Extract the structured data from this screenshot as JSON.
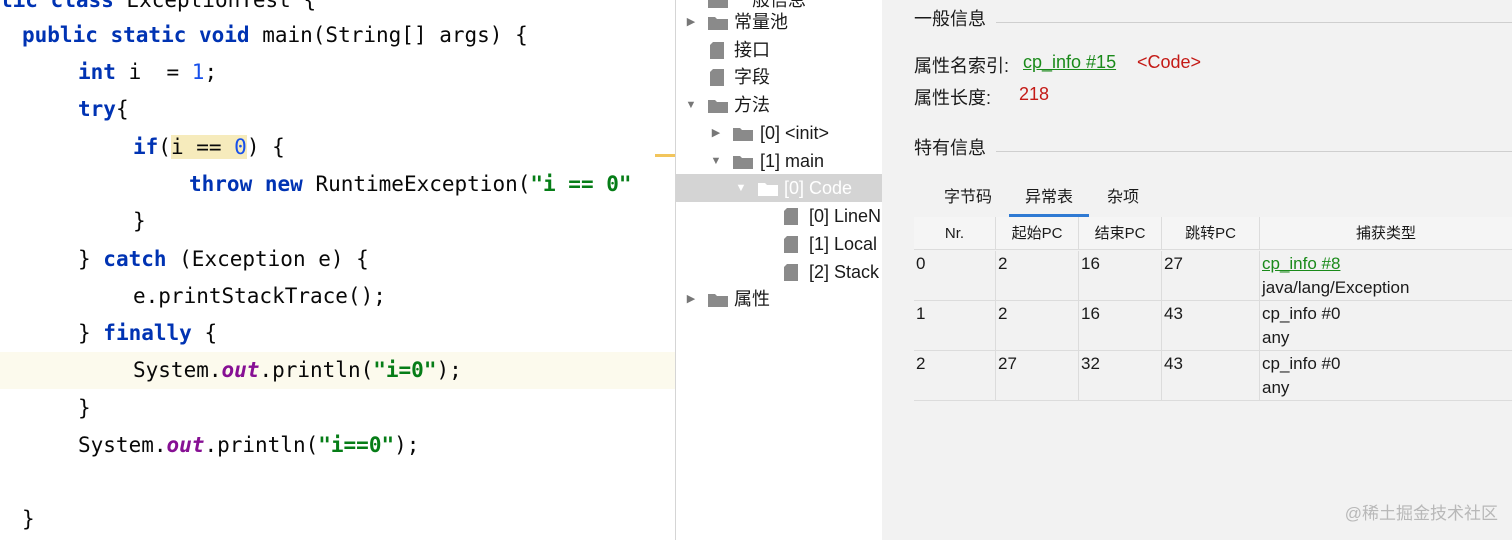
{
  "editor": {
    "lines": [
      "lic class ExceptionTest {",
      "public static void main(String[] args) {",
      "int i  = 1;",
      "try{",
      "if(i == 0) {",
      "throw new RuntimeException(\"i == 0\"",
      "}",
      "} catch (Exception e) {",
      "e.printStackTrace();",
      "} finally {",
      "System.out.println(\"i=0\");",
      "}",
      "System.out.println(\"i==0\");",
      "",
      "}"
    ],
    "tokens": {
      "l0_kw": "lic class",
      "l0_rest": " ExceptionTest {",
      "l1_kw": "public static void",
      "l1_rest": " main(String[] args) {",
      "l2_kw": "int",
      "l2_mid": " i  = ",
      "l2_num": "1",
      "l2_end": ";",
      "l3_kw": "try",
      "l3_end": "{",
      "l4_kw": "if",
      "l4_p": "(",
      "l4_match1": "i == ",
      "l4_num": "0",
      "l4_end": ") {",
      "l5_kw": "throw new",
      "l5_mid": " RuntimeException(",
      "l5_str": "\"i == 0\"",
      "l6": "}",
      "l7_a": "} ",
      "l7_kw": "catch",
      "l7_rest": " (Exception e) {",
      "l8": "e.printStackTrace();",
      "l9_a": "} ",
      "l9_kw": "finally",
      "l9_rest": " {",
      "l10_a": "System.",
      "l10_field": "out",
      "l10_b": ".println(",
      "l10_str": "\"i=0\"",
      "l10_end": ");",
      "l11": "}",
      "l12_a": "System.",
      "l12_field": "out",
      "l12_b": ".println(",
      "l12_str": "\"i==0\"",
      "l12_end": ");",
      "l14": "}"
    }
  },
  "tree": {
    "items": [
      {
        "label": "一般信息"
      },
      {
        "label": "常量池"
      },
      {
        "label": "接口"
      },
      {
        "label": "字段"
      },
      {
        "label": "方法"
      },
      {
        "label": "[0] <init>"
      },
      {
        "label": "[1] main"
      },
      {
        "label": "[0] Code"
      },
      {
        "label": "[0] LineN"
      },
      {
        "label": "[1] Local"
      },
      {
        "label": "[2] Stack"
      },
      {
        "label": "属性"
      }
    ]
  },
  "detail": {
    "general_title": "一般信息",
    "attr_name_label": "属性名索引:",
    "attr_name_link": "cp_info #15",
    "attr_name_value": "<Code>",
    "attr_len_label": "属性长度:",
    "attr_len_value": "218",
    "specific_title": "特有信息",
    "tabs": [
      "字节码",
      "异常表",
      "杂项"
    ],
    "active_tab": "异常表",
    "table": {
      "headers": [
        "Nr.",
        "起始PC",
        "结束PC",
        "跳转PC",
        "捕获类型"
      ],
      "rows": [
        {
          "nr": "0",
          "start": "2",
          "end": "16",
          "handler": "27",
          "type_ref": "cp_info #8",
          "type_name": "java/lang/Exception"
        },
        {
          "nr": "1",
          "start": "2",
          "end": "16",
          "handler": "43",
          "type_ref": "cp_info #0",
          "type_name": "any"
        },
        {
          "nr": "2",
          "start": "27",
          "end": "32",
          "handler": "43",
          "type_ref": "cp_info #0",
          "type_name": "any"
        }
      ]
    }
  },
  "watermark": "@稀土掘金技术社区",
  "colors": {
    "keyword": "#0033b3",
    "string": "#067d17",
    "number": "#1750eb",
    "field": "#871094",
    "link": "#1a8a1a",
    "value_red": "#c41a16",
    "tab_accent": "#2f7ad3",
    "selected_row": "#d4d4d4"
  }
}
